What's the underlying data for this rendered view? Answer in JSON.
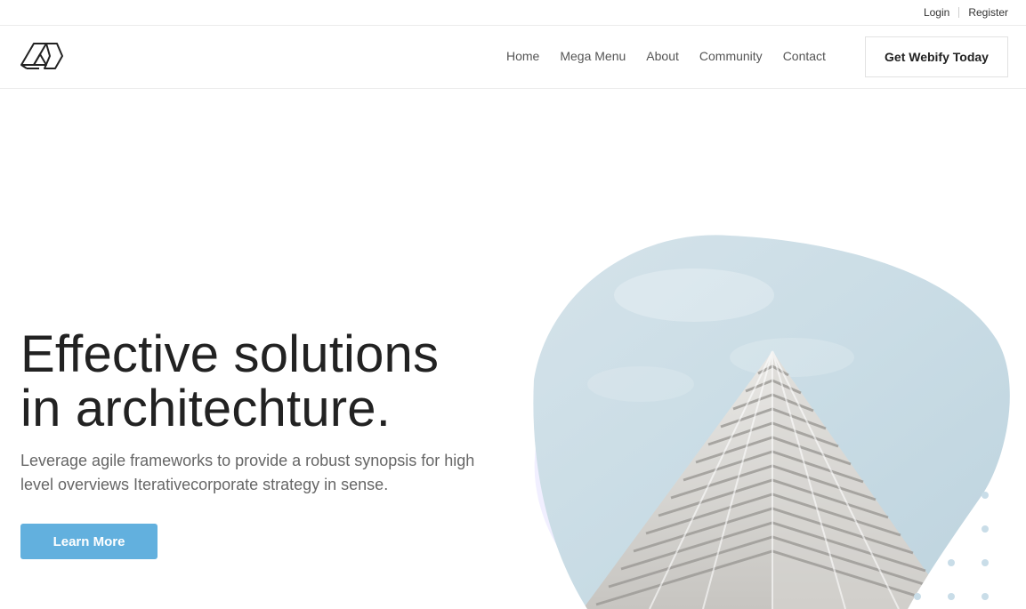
{
  "topbar": {
    "login_label": "Login",
    "register_label": "Register"
  },
  "header": {
    "logo_icon": "hexagon-logo-icon",
    "nav_items": [
      "Home",
      "Mega Menu",
      "About",
      "Community",
      "Contact"
    ],
    "cta_label": "Get Webify Today"
  },
  "hero": {
    "title_line1": "Effective solutions",
    "title_line2": "in architechture.",
    "description": "Leverage agile frameworks to provide a robust synopsis for high level overviews Iterativecorporate strategy in sense.",
    "button_label": "Learn More",
    "image": "building-photo",
    "accent_color": "#62b0de",
    "decor_color": "#f1efff",
    "dot_color": "#c9dde8"
  }
}
